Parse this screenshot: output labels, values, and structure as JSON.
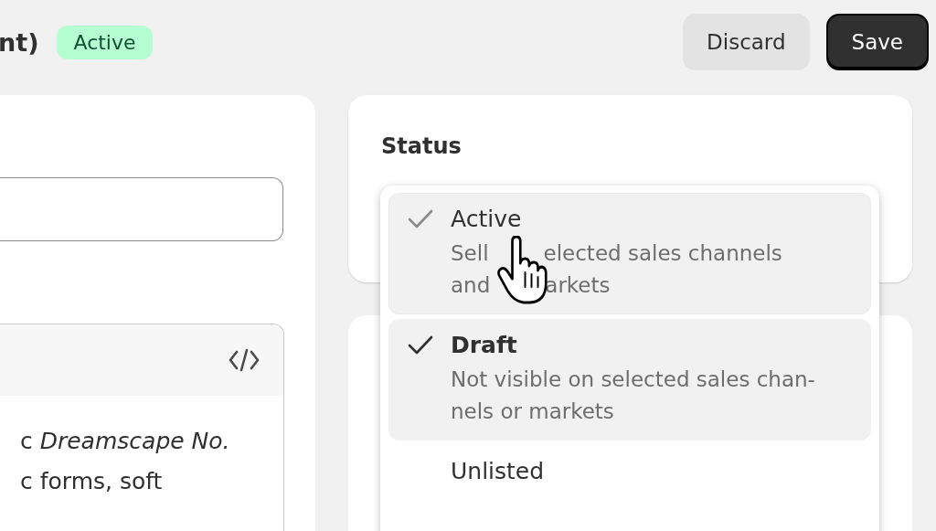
{
  "header": {
    "title": "nt)",
    "badge": "Active"
  },
  "actions": [
    {
      "label": "Discard",
      "kind": "secondary"
    },
    {
      "label": "Save",
      "kind": "primary"
    }
  ],
  "editor": {
    "lines": [
      "c *Dreamscape No.*",
      "c forms, soft"
    ]
  },
  "status": {
    "title": "Status"
  },
  "status_menu": [
    {
      "label": "Active",
      "description_lines": [
        [
          "Sell",
          "elected sales channels"
        ],
        [
          "and",
          "arkets"
        ]
      ],
      "selected": false,
      "hovered": true
    },
    {
      "label": "Draft",
      "description_lines": [
        [
          "Not visible on selected sales chan-"
        ],
        [
          "nels or markets"
        ]
      ],
      "selected": true,
      "hovered": false
    },
    {
      "label": "Unlisted",
      "selected": false,
      "hovered": false
    }
  ]
}
